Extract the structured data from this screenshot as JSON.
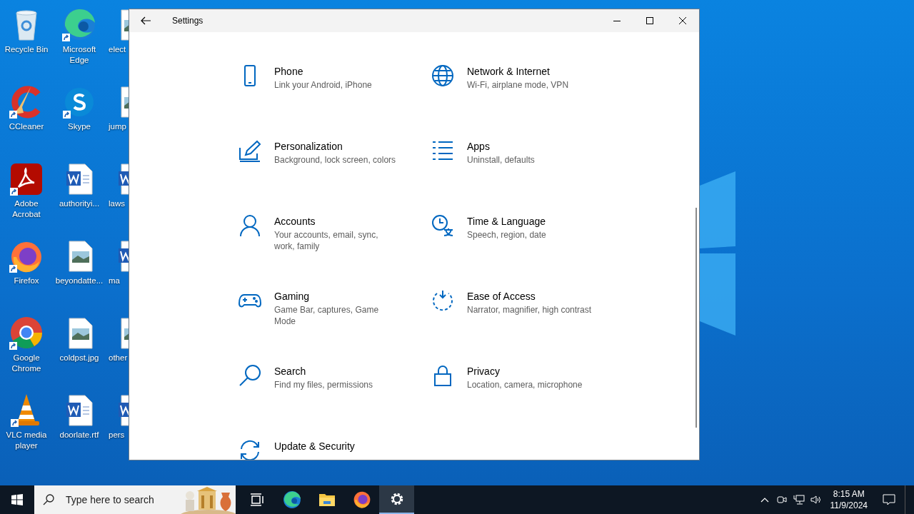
{
  "desktop": {
    "icons": [
      {
        "label": "Recycle Bin",
        "kind": "recycle",
        "shortcut": false
      },
      {
        "label": "CCleaner",
        "kind": "ccleaner",
        "shortcut": true
      },
      {
        "label": "Adobe Acrobat",
        "kind": "acrobat",
        "shortcut": true
      },
      {
        "label": "Firefox",
        "kind": "firefox",
        "shortcut": true
      },
      {
        "label": "Google Chrome",
        "kind": "chrome",
        "shortcut": true
      },
      {
        "label": "VLC media player",
        "kind": "vlc",
        "shortcut": true
      },
      {
        "label": "Microsoft Edge",
        "kind": "edge",
        "shortcut": true
      },
      {
        "label": "Skype",
        "kind": "skype",
        "shortcut": true
      },
      {
        "label": "authorityi...",
        "kind": "word",
        "shortcut": false
      },
      {
        "label": "beyondatte...",
        "kind": "image",
        "shortcut": false
      },
      {
        "label": "coldpst.jpg",
        "kind": "image",
        "shortcut": false
      },
      {
        "label": "doorlate.rtf",
        "kind": "word",
        "shortcut": false
      },
      {
        "label": "elect",
        "kind": "image",
        "shortcut": false
      },
      {
        "label": "jump",
        "kind": "image",
        "shortcut": false
      },
      {
        "label": "laws",
        "kind": "word",
        "shortcut": false
      },
      {
        "label": "ma",
        "kind": "word",
        "shortcut": false
      },
      {
        "label": "other",
        "kind": "image",
        "shortcut": false
      },
      {
        "label": "pers",
        "kind": "word",
        "shortcut": false
      }
    ]
  },
  "window": {
    "title": "Settings",
    "items": [
      {
        "kind": "phone",
        "title": "Phone",
        "subtitle": "Link your Android, iPhone"
      },
      {
        "kind": "network",
        "title": "Network & Internet",
        "subtitle": "Wi-Fi, airplane mode, VPN"
      },
      {
        "kind": "personalization",
        "title": "Personalization",
        "subtitle": "Background, lock screen, colors"
      },
      {
        "kind": "apps",
        "title": "Apps",
        "subtitle": "Uninstall, defaults"
      },
      {
        "kind": "accounts",
        "title": "Accounts",
        "subtitle": "Your accounts, email, sync, work, family"
      },
      {
        "kind": "time",
        "title": "Time & Language",
        "subtitle": "Speech, region, date"
      },
      {
        "kind": "gaming",
        "title": "Gaming",
        "subtitle": "Game Bar, captures, Game Mode"
      },
      {
        "kind": "ease",
        "title": "Ease of Access",
        "subtitle": "Narrator, magnifier, high contrast"
      },
      {
        "kind": "search",
        "title": "Search",
        "subtitle": "Find my files, permissions"
      },
      {
        "kind": "privacy",
        "title": "Privacy",
        "subtitle": "Location, camera, microphone"
      },
      {
        "kind": "update",
        "title": "Update & Security"
      }
    ]
  },
  "taskbar": {
    "search": {
      "placeholder": "Type here to search"
    },
    "apps": [
      {
        "kind": "taskview",
        "selected": false
      },
      {
        "kind": "edge",
        "selected": false
      },
      {
        "kind": "explorer",
        "selected": false
      },
      {
        "kind": "firefox",
        "selected": false
      },
      {
        "kind": "settings",
        "selected": true
      }
    ],
    "time": "8:15 AM",
    "date": "11/9/2024"
  }
}
